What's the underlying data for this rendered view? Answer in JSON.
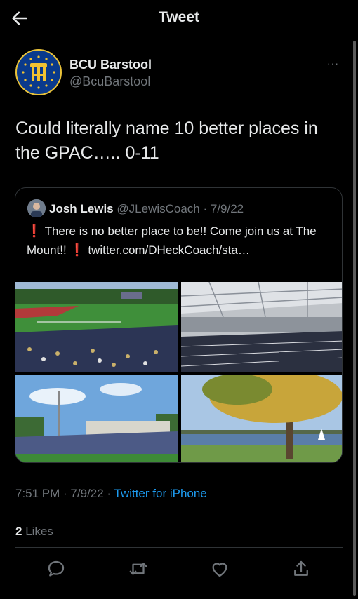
{
  "header": {
    "title": "Tweet"
  },
  "tweet": {
    "name": "BCU Barstool",
    "handle": "@BcuBarstool",
    "more": "···",
    "text": "Could literally name 10 better places in the GPAC….. 0-11",
    "timestamp": "7:51 PM · 7/9/22 · ",
    "source": "Twitter for iPhone",
    "likes_count": "2",
    "likes_label": " Likes"
  },
  "quote": {
    "name": "Josh Lewis",
    "handle": "@JLewisCoach",
    "date": " · 7/9/22",
    "text_part1": "There is no better place to be!! Come join us at The Mount!! ",
    "text_part2": " twitter.com/DHeckCoach/sta…",
    "excl": "❗"
  },
  "colors": {
    "background": "#000000",
    "text": "#e7e9ea",
    "muted": "#71767b",
    "link": "#1d9bf0",
    "avatar": "#0a3a8c"
  }
}
